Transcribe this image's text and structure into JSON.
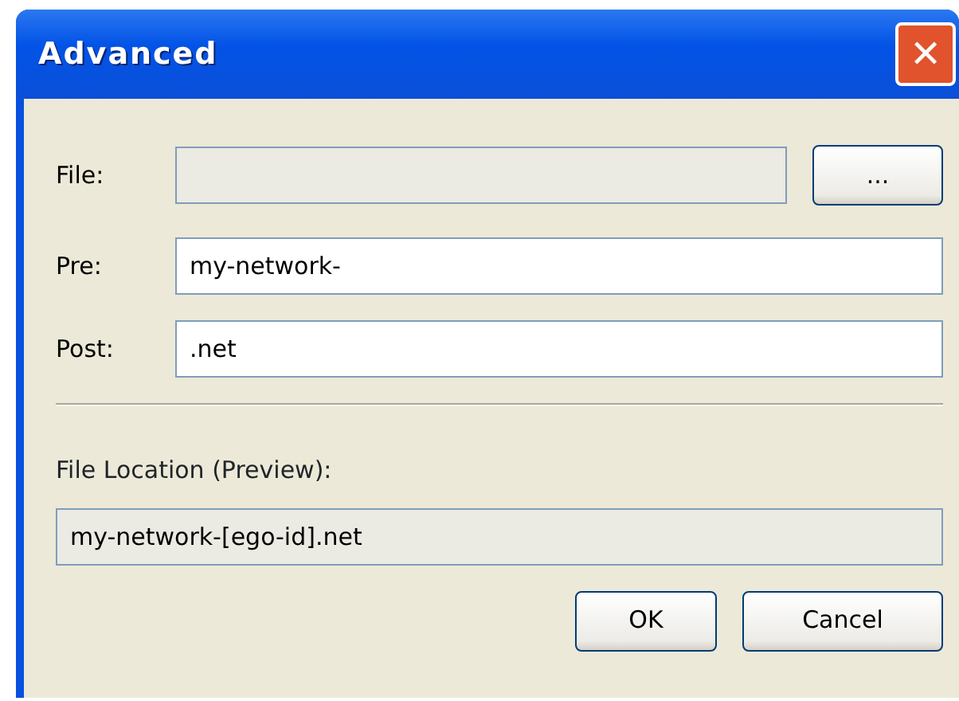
{
  "window": {
    "title": "Advanced",
    "close": "✕"
  },
  "fields": [
    {
      "label": "File:",
      "disabled": true,
      "browse": "..."
    },
    {
      "label": "Pre:",
      "value": "my-network-",
      "disabled": false
    },
    {
      "label": "Post:",
      "value": ".net",
      "disabled": false
    }
  ],
  "preview": {
    "label": "File Location (Preview):",
    "value": "my-network-[ego-id].net",
    "disabled": true
  },
  "buttons": [
    "OK",
    "Cancel"
  ]
}
